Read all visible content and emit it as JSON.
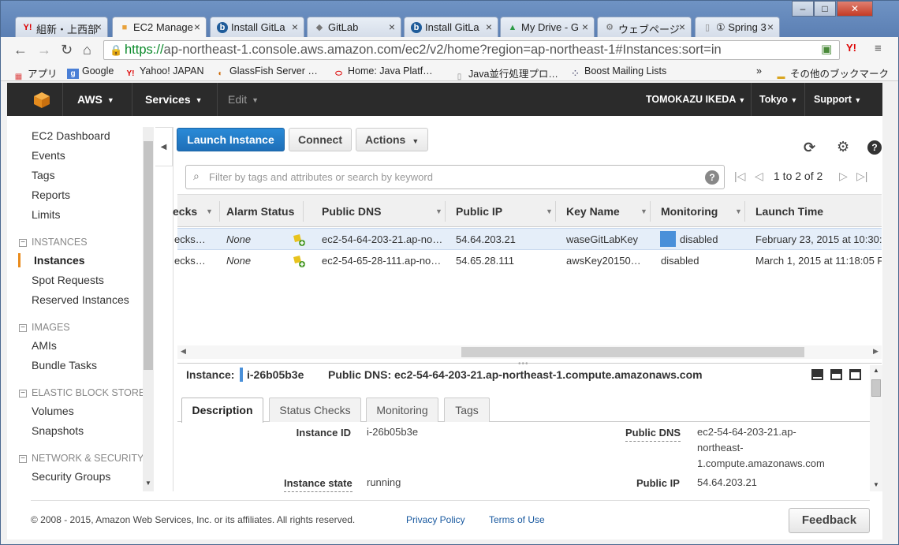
{
  "browser": {
    "tabs": [
      {
        "label": "組新・上西部",
        "icon": "Y!",
        "active": false
      },
      {
        "label": "EC2 Manage",
        "icon": "box",
        "active": true
      },
      {
        "label": "Install GitLa",
        "icon": "b",
        "active": false
      },
      {
        "label": "GitLab",
        "icon": "fox",
        "active": false
      },
      {
        "label": "Install GitLa",
        "icon": "b",
        "active": false
      },
      {
        "label": "My Drive - G",
        "icon": "drive",
        "active": false
      },
      {
        "label": "ウェブページ",
        "icon": "web",
        "active": false
      },
      {
        "label": "① Spring 3",
        "icon": "page",
        "active": false
      }
    ],
    "url_secure": "https://",
    "url_rest": "ap-northeast-1.console.aws.amazon.com/ec2/v2/home?region=ap-northeast-1#Instances:sort=in",
    "bookmarks": [
      {
        "label": "アプリ",
        "icon": "apps"
      },
      {
        "label": "Google",
        "icon": "g"
      },
      {
        "label": "Yahoo! JAPAN",
        "icon": "Y!"
      },
      {
        "label": "GlassFish Server …",
        "icon": "fish"
      },
      {
        "label": "Home: Java Platf…",
        "icon": "oracle"
      },
      {
        "label": "Java並行処理プロ…",
        "icon": "page"
      },
      {
        "label": "Boost Mailing Lists",
        "icon": "dots"
      },
      {
        "label": "»",
        "icon": ""
      },
      {
        "label": "その他のブックマーク",
        "icon": "folder"
      }
    ]
  },
  "aws_header": {
    "brand": "AWS",
    "services": "Services",
    "edit": "Edit",
    "user": "TOMOKAZU IKEDA",
    "region": "Tokyo",
    "support": "Support"
  },
  "sidebar": {
    "top_items": [
      "EC2 Dashboard",
      "Events",
      "Tags",
      "Reports",
      "Limits"
    ],
    "sections": [
      {
        "title": "INSTANCES",
        "items": [
          "Instances",
          "Spot Requests",
          "Reserved Instances"
        ]
      },
      {
        "title": "IMAGES",
        "items": [
          "AMIs",
          "Bundle Tasks"
        ]
      },
      {
        "title": "ELASTIC BLOCK STORE",
        "items": [
          "Volumes",
          "Snapshots"
        ]
      },
      {
        "title": "NETWORK & SECURITY",
        "items": [
          "Security Groups"
        ]
      }
    ],
    "active_item": "Instances"
  },
  "actions": {
    "launch": "Launch Instance",
    "connect": "Connect",
    "actions": "Actions"
  },
  "filter": {
    "placeholder": "Filter by tags and attributes or search by keyword",
    "pager": "1 to 2 of 2"
  },
  "table": {
    "columns": [
      "ecks",
      "Alarm Status",
      "Public DNS",
      "Public IP",
      "Key Name",
      "Monitoring",
      "Launch Time"
    ],
    "rows": [
      {
        "checks": "ecks…",
        "alarm": "None",
        "dns": "ec2-54-64-203-21.ap-no…",
        "ip": "54.64.203.21",
        "key": "waseGitLabKey",
        "monitoring": "disabled",
        "launch": "February 23, 2015 at 10:30:",
        "selected": true
      },
      {
        "checks": "ecks…",
        "alarm": "None",
        "dns": "ec2-54-65-28-111.ap-no…",
        "ip": "54.65.28.111",
        "key": "awsKey20150…",
        "monitoring": "disabled",
        "launch": "March 1, 2015 at 11:18:05 F",
        "selected": false
      }
    ]
  },
  "detail": {
    "instance_label": "Instance:",
    "instance_id": "i-26b05b3e",
    "dns_label": "Public DNS:",
    "dns_value": "ec2-54-64-203-21.ap-northeast-1.compute.amazonaws.com",
    "tabs": [
      "Description",
      "Status Checks",
      "Monitoring",
      "Tags"
    ],
    "fields": {
      "instance_id_label": "Instance ID",
      "instance_id_value": "i-26b05b3e",
      "instance_state_label": "Instance state",
      "instance_state_value": "running",
      "public_dns_label": "Public DNS",
      "public_dns_line1": "ec2-54-64-203-21.ap-",
      "public_dns_line2": "northeast-",
      "public_dns_line3": "1.compute.amazonaws.com",
      "public_ip_label": "Public IP",
      "public_ip_value": "54.64.203.21"
    }
  },
  "footer": {
    "copyright": "© 2008 - 2015, Amazon Web Services, Inc. or its affiliates. All rights reserved.",
    "privacy": "Privacy Policy",
    "terms": "Terms of Use",
    "feedback": "Feedback"
  },
  "colors": {
    "primary_button": "#1e6fb8",
    "aws_bar": "#2b2b2b",
    "active_marker": "#e98b1c",
    "monitoring_box": "#4a90d9"
  }
}
